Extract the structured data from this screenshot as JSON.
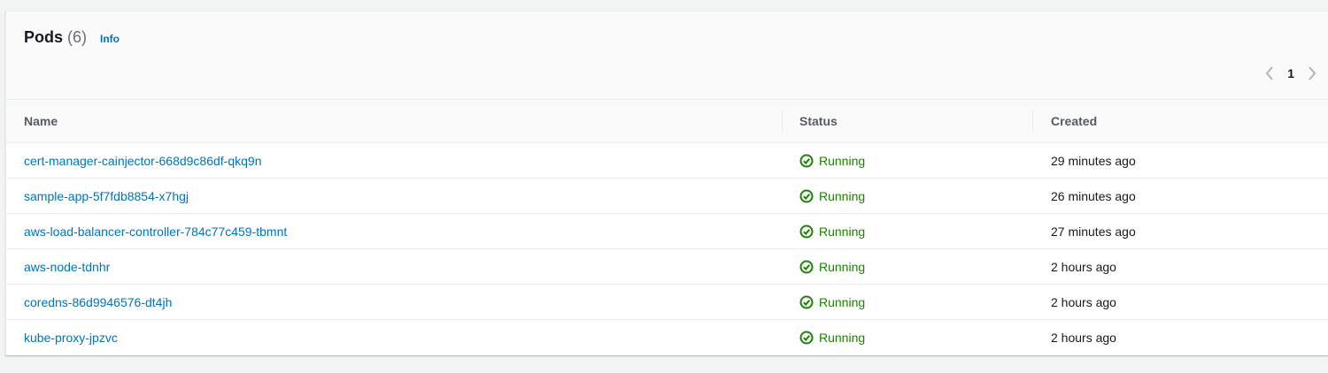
{
  "header": {
    "title": "Pods",
    "count": "(6)",
    "info_label": "Info"
  },
  "pagination": {
    "current_page": "1",
    "prev_icon": "chevron-left-icon",
    "next_icon": "chevron-right-icon"
  },
  "table": {
    "columns": [
      "Name",
      "Status",
      "Created"
    ],
    "rows": [
      {
        "name": "cert-manager-cainjector-668d9c86df-qkq9n",
        "status": "Running",
        "created": "29 minutes ago"
      },
      {
        "name": "sample-app-5f7fdb8854-x7hgj",
        "status": "Running",
        "created": "26 minutes ago"
      },
      {
        "name": "aws-load-balancer-controller-784c77c459-tbmnt",
        "status": "Running",
        "created": "27 minutes ago"
      },
      {
        "name": "aws-node-tdnhr",
        "status": "Running",
        "created": "2 hours ago"
      },
      {
        "name": "coredns-86d9946576-dt4jh",
        "status": "Running",
        "created": "2 hours ago"
      },
      {
        "name": "kube-proxy-jpzvc",
        "status": "Running",
        "created": "2 hours ago"
      }
    ]
  },
  "colors": {
    "link": "#0073bb",
    "success": "#1d8102",
    "text": "#16191f",
    "muted": "#687078"
  }
}
